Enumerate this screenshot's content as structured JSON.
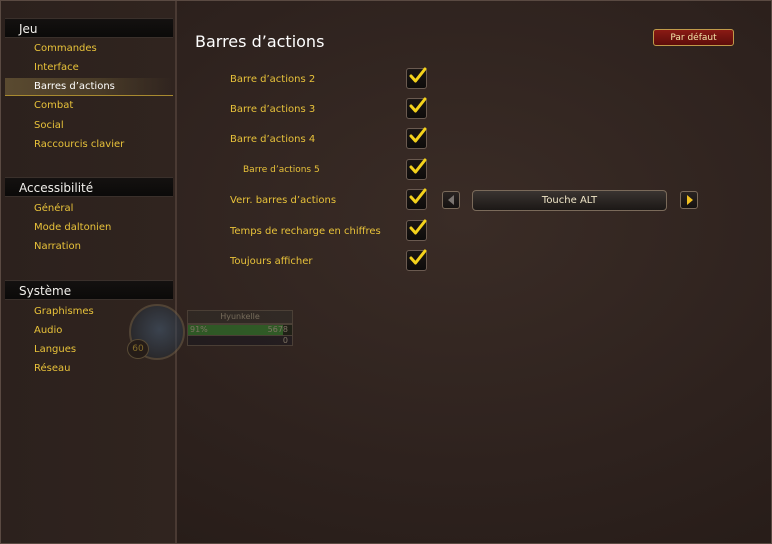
{
  "sidebar": {
    "sections": [
      {
        "title": "Jeu",
        "items": [
          "Commandes",
          "Interface",
          "Barres d’actions",
          "Combat",
          "Social",
          "Raccourcis clavier"
        ]
      },
      {
        "title": "Accessibilité",
        "items": [
          "Général",
          "Mode daltonien",
          "Narration"
        ]
      },
      {
        "title": "Système",
        "items": [
          "Graphismes",
          "Audio",
          "Langues",
          "Réseau"
        ]
      }
    ],
    "selected_item": "Barres d’actions"
  },
  "main": {
    "title": "Barres d’actions",
    "reset_button": "Par défaut",
    "options": [
      {
        "label": "Barre d’actions 2",
        "checked": true
      },
      {
        "label": "Barre d’actions 3",
        "checked": true
      },
      {
        "label": "Barre d’actions 4",
        "checked": true
      },
      {
        "label": "Barre d’actions 5",
        "checked": true,
        "indented": true
      },
      {
        "label": "Verr. barres d’actions",
        "checked": true
      },
      {
        "label": "Temps de recharge en chiffres",
        "checked": true
      },
      {
        "label": "Toujours afficher",
        "checked": true
      }
    ],
    "lock_dropdown": {
      "value": "Touche ALT"
    }
  },
  "unit_frame": {
    "name": "Hyunkelle",
    "level": "60",
    "health_pct": "91%",
    "health_value": "5678",
    "health_fraction": 0.91,
    "mana_value": "0"
  },
  "colors": {
    "accent_gold": "#e8c23a",
    "reset_button_red": "#8a1a14",
    "checkmark": "#f4d21c"
  },
  "icons": [
    "checkmark-icon",
    "arrow-left-icon",
    "arrow-right-icon"
  ]
}
